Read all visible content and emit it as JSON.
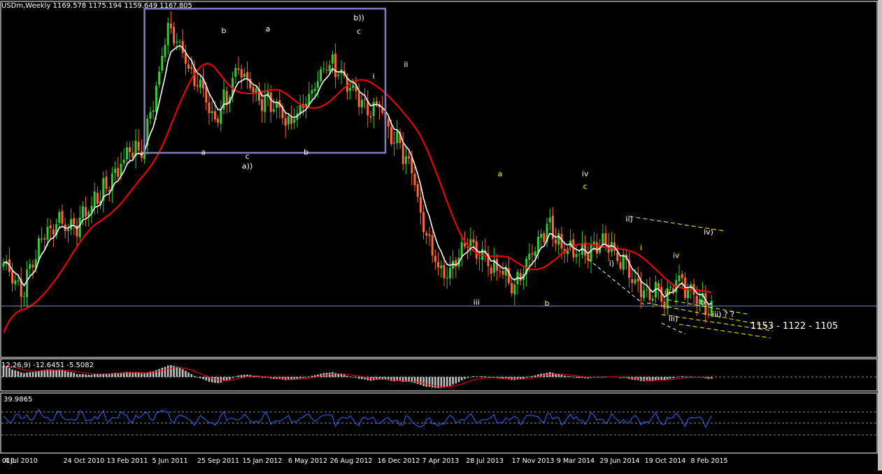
{
  "chart_data": {
    "type": "candlestick",
    "symbol_header": "USDm,Weekly  1169.578 1175.194 1159.649 116?.805",
    "time_labels": [
      "010",
      "4 Jul 2010",
      "24 Oct 2010",
      "13 Feb 2011",
      "5 Jun 2011",
      "25 Sep 2011",
      "15 Jan 2012",
      "6 May 2012",
      "26 Aug 2012",
      "16 Dec 2012",
      "7 Apr 2013",
      "28 Jul 2013",
      "17 Nov 2013",
      "9 Mar 2014",
      "29 Jun 2014",
      "19 Oct 2014",
      "8 Feb 2015"
    ],
    "ylim": [
      1030,
      1940
    ],
    "price_key_points": [
      [
        0,
        1260
      ],
      [
        6,
        1195
      ],
      [
        12,
        1310
      ],
      [
        18,
        1380
      ],
      [
        24,
        1365
      ],
      [
        30,
        1420
      ],
      [
        36,
        1480
      ],
      [
        42,
        1550
      ],
      [
        48,
        1580
      ],
      [
        52,
        1720
      ],
      [
        56,
        1880
      ],
      [
        60,
        1820
      ],
      [
        64,
        1750
      ],
      [
        68,
        1720
      ],
      [
        72,
        1640
      ],
      [
        76,
        1700
      ],
      [
        80,
        1780
      ],
      [
        84,
        1730
      ],
      [
        88,
        1680
      ],
      [
        92,
        1690
      ],
      [
        96,
        1640
      ],
      [
        100,
        1650
      ],
      [
        104,
        1690
      ],
      [
        108,
        1760
      ],
      [
        112,
        1780
      ],
      [
        116,
        1740
      ],
      [
        120,
        1700
      ],
      [
        124,
        1670
      ],
      [
        128,
        1680
      ],
      [
        132,
        1600
      ],
      [
        136,
        1560
      ],
      [
        140,
        1480
      ],
      [
        143,
        1360
      ],
      [
        146,
        1300
      ],
      [
        150,
        1230
      ],
      [
        154,
        1290
      ],
      [
        158,
        1330
      ],
      [
        162,
        1290
      ],
      [
        166,
        1260
      ],
      [
        170,
        1250
      ],
      [
        174,
        1220
      ],
      [
        178,
        1270
      ],
      [
        182,
        1330
      ],
      [
        186,
        1370
      ],
      [
        190,
        1310
      ],
      [
        194,
        1300
      ],
      [
        198,
        1290
      ],
      [
        202,
        1320
      ],
      [
        206,
        1320
      ],
      [
        210,
        1280
      ],
      [
        214,
        1240
      ],
      [
        218,
        1190
      ],
      [
        222,
        1200
      ],
      [
        226,
        1180
      ],
      [
        230,
        1230
      ],
      [
        233,
        1210
      ],
      [
        236,
        1195
      ],
      [
        239,
        1162
      ]
    ],
    "series": [
      {
        "name": "",
        "color": "#ffffff"
      },
      {
        "name": "",
        "color": "#ff0000"
      }
    ],
    "channel_color": "#ffff00",
    "box_color": "#8080c0",
    "horizontal_line": 1162,
    "wave_labels_white": [
      {
        "text": "b",
        "x": 75,
        "price": 1862
      },
      {
        "text": "a",
        "x": 90,
        "price": 1867
      },
      {
        "text": "b))",
        "x": 121,
        "price": 1895
      },
      {
        "text": "c",
        "x": 121,
        "price": 1860
      },
      {
        "text": "ii",
        "x": 137,
        "price": 1775
      },
      {
        "text": "i",
        "x": 126,
        "price": 1745
      },
      {
        "text": "a",
        "x": 68,
        "price": 1550
      },
      {
        "text": "c",
        "x": 83,
        "price": 1540
      },
      {
        "text": "a))",
        "x": 83,
        "price": 1515
      },
      {
        "text": "b",
        "x": 103,
        "price": 1550
      },
      {
        "text": "iii",
        "x": 161,
        "price": 1165
      },
      {
        "text": "iv",
        "x": 198,
        "price": 1495
      },
      {
        "text": "i)",
        "x": 207,
        "price": 1265
      },
      {
        "text": "ii)",
        "x": 213,
        "price": 1378
      },
      {
        "text": "iv)",
        "x": 240,
        "price": 1345
      },
      {
        "text": "iii)",
        "x": 228,
        "price": 1123
      },
      {
        "text": "b",
        "x": 238,
        "price": 1165
      },
      {
        "text": "iii) ? ?",
        "x": 245,
        "price": 1134
      }
    ],
    "wave_labels_yellow": [
      {
        "text": "a",
        "x": 169,
        "price": 1495
      },
      {
        "text": "c",
        "x": 198,
        "price": 1463
      },
      {
        "text": "b",
        "x": 185,
        "price": 1163
      },
      {
        "text": "iv",
        "x": 229,
        "price": 1285
      },
      {
        "text": "i",
        "x": 217,
        "price": 1305
      },
      {
        "text": "iii",
        "x": 226,
        "price": 1190
      }
    ],
    "annotation_target": "1153 - 1122 - 1105",
    "macd_label": "12,26,9) -12.6451 -5.5082",
    "rsi_label": "39.9865"
  }
}
